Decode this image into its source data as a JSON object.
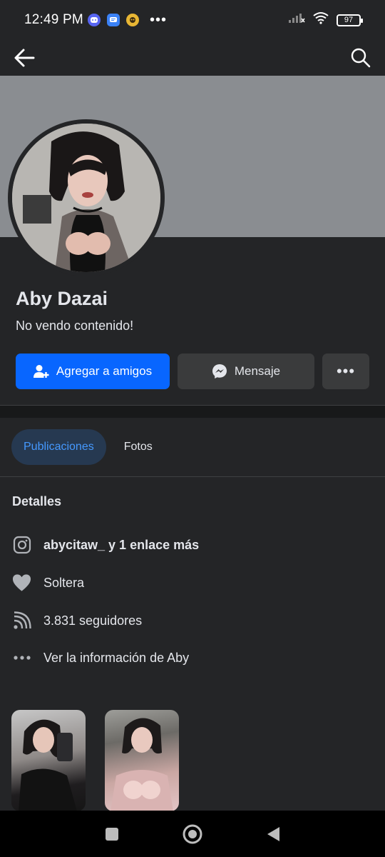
{
  "status_bar": {
    "time": "12:49 PM",
    "battery": "97",
    "app_icons": [
      "discord-icon",
      "messages-icon",
      "game-icon"
    ],
    "more_dots": "•••"
  },
  "top_bar": {
    "back_icon": "arrow-left-icon",
    "search_icon": "search-icon"
  },
  "profile": {
    "name": "Aby Dazai",
    "bio": "No vendo contenido!"
  },
  "actions": {
    "add_friend_label": "Agregar a amigos",
    "message_label": "Mensaje",
    "more_label": "•••"
  },
  "tabs": [
    {
      "label": "Publicaciones",
      "active": true
    },
    {
      "label": "Fotos",
      "active": false
    }
  ],
  "details": {
    "title": "Detalles",
    "items": [
      {
        "icon": "instagram-icon",
        "text": "abycitaw_ y 1 enlace más"
      },
      {
        "icon": "heart-icon",
        "text": "Soltera"
      },
      {
        "icon": "rss-icon",
        "text": "3.831 seguidores"
      },
      {
        "icon": "more-dots-icon",
        "text": "Ver la información de Aby"
      }
    ]
  },
  "colors": {
    "background": "#242527",
    "primary": "#0866ff",
    "secondary_button": "#3a3b3c",
    "active_tab_bg": "#263951",
    "active_tab_text": "#4599ff",
    "cover": "#8a8d91"
  }
}
